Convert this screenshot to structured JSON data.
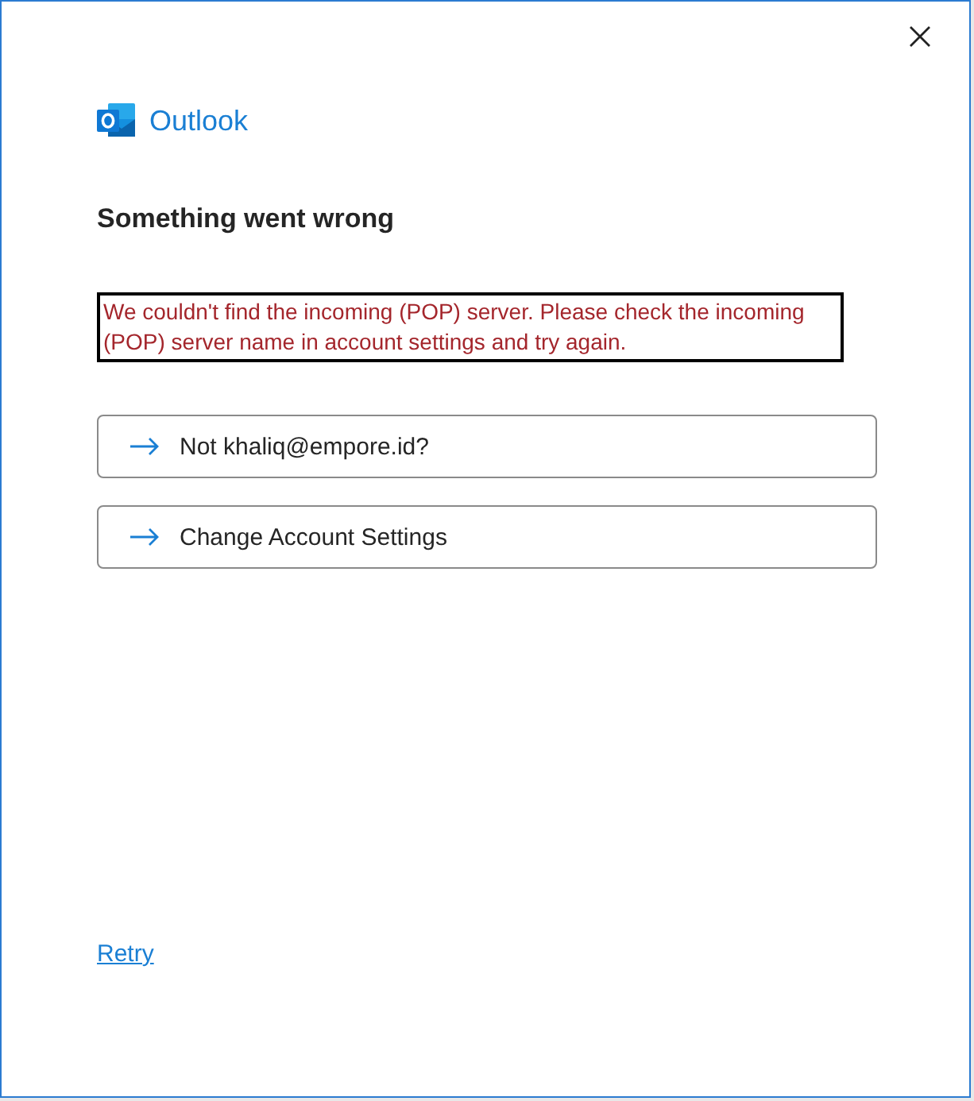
{
  "app": {
    "name": "Outlook"
  },
  "heading": "Something went wrong",
  "error_message": "We couldn't find the incoming (POP) server. Please check the incoming (POP) server name in account settings and try again.",
  "actions": [
    {
      "label": "Not khaliq@empore.id?"
    },
    {
      "label": "Change Account Settings"
    }
  ],
  "retry_link": "Retry"
}
